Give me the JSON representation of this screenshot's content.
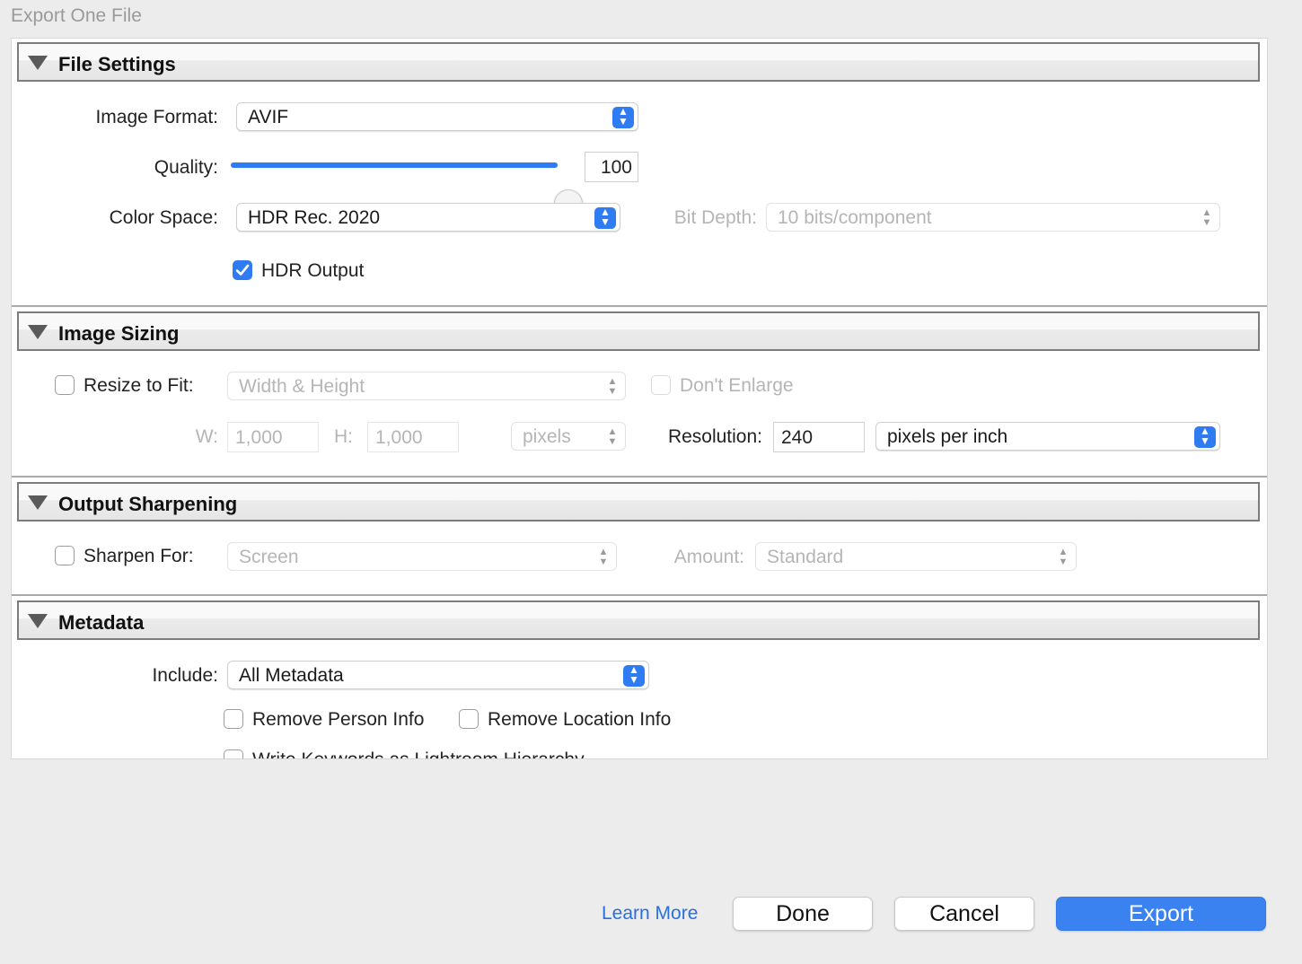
{
  "window": {
    "title": "Export One File"
  },
  "file_settings": {
    "header": "File Settings",
    "image_format_label": "Image Format:",
    "image_format_value": "AVIF",
    "quality_label": "Quality:",
    "quality_value": "100",
    "quality_fraction": 1.0,
    "color_space_label": "Color Space:",
    "color_space_value": "HDR Rec. 2020",
    "bit_depth_label": "Bit Depth:",
    "bit_depth_value": "10 bits/component",
    "hdr_output_label": "HDR Output",
    "hdr_output_checked": true
  },
  "image_sizing": {
    "header": "Image Sizing",
    "resize_label": "Resize to Fit:",
    "resize_checked": false,
    "resize_value": "Width & Height",
    "dont_enlarge_label": "Don't Enlarge",
    "w_label": "W:",
    "w_value": "1,000",
    "h_label": "H:",
    "h_value": "1,000",
    "units_value": "pixels",
    "resolution_label": "Resolution:",
    "resolution_value": "240",
    "resolution_units": "pixels per inch"
  },
  "output_sharpening": {
    "header": "Output Sharpening",
    "sharpen_label": "Sharpen For:",
    "sharpen_checked": false,
    "sharpen_value": "Screen",
    "amount_label": "Amount:",
    "amount_value": "Standard"
  },
  "metadata": {
    "header": "Metadata",
    "include_label": "Include:",
    "include_value": "All Metadata",
    "remove_person_label": "Remove Person Info",
    "remove_location_label": "Remove Location Info",
    "write_keywords_label": "Write Keywords as Lightroom Hierarchy"
  },
  "footer": {
    "learn_more": "Learn More",
    "done": "Done",
    "cancel": "Cancel",
    "export": "Export"
  },
  "colors": {
    "accent": "#2f7bf1",
    "link": "#2a6fe0"
  }
}
